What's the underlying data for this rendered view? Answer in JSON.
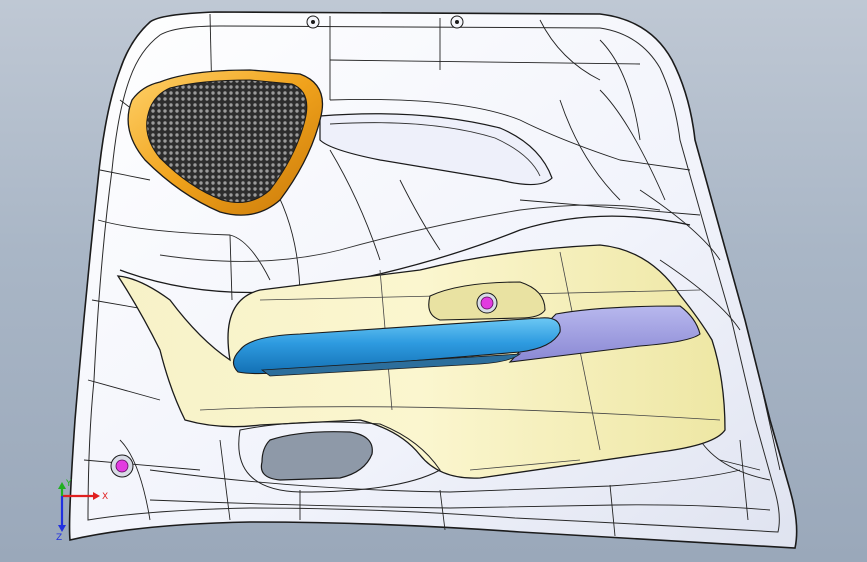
{
  "viewport": {
    "name": "cad-3d-viewport",
    "model": "door-trim-panel",
    "colors": {
      "background_top": "#bfc8d4",
      "background_bottom": "#9aa8ba",
      "panel_surface": "#f3f5fc",
      "panel_edges": "#1b1b1b",
      "speaker_bezel": "#f0a21c",
      "speaker_grille": "#3a3a3a",
      "insert_fabric": "#f4f0b6",
      "armrest_blue": "#2e9be0",
      "armrest_lavender": "#9d9ce0",
      "fastener_magenta": "#e23be0"
    }
  },
  "triad": {
    "x_label": "X",
    "y_label": "Y",
    "z_label": "Z",
    "x_color": "#e02020",
    "y_color": "#20b020",
    "z_color": "#2030e0"
  }
}
